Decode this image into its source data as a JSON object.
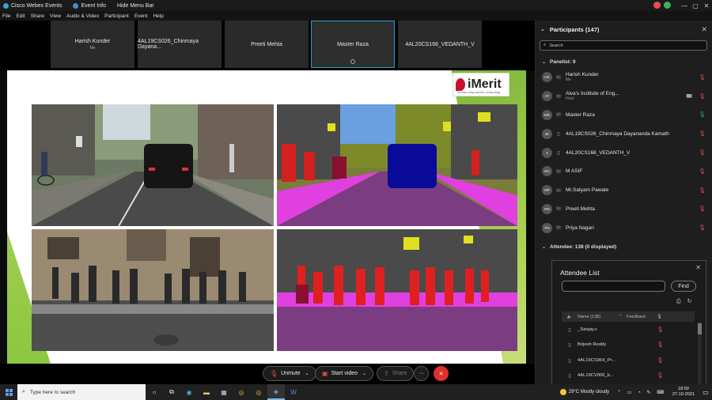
{
  "titlebar": {
    "app_name": "Cisco Webex Events",
    "event_info": "Event Info",
    "hide_menu": "Hide Menu Bar",
    "controls": [
      "—",
      "▢",
      "✕"
    ]
  },
  "menubar": [
    "File",
    "Edit",
    "Share",
    "View",
    "Audio & Video",
    "Participant",
    "Event",
    "Help"
  ],
  "video_strip": [
    {
      "name": "Harish Kunder",
      "sub": "Me",
      "active": false
    },
    {
      "name": "4AL19CS026_Chinmaya Dayana...",
      "sub": "",
      "active": false
    },
    {
      "name": "Preeti Mehta",
      "sub": "",
      "active": false
    },
    {
      "name": "Master Raza",
      "sub": "",
      "active": true
    },
    {
      "name": "4AL20CS168_VEDANTH_V",
      "sub": "",
      "active": false
    }
  ],
  "slide": {
    "logo_name": "iMerit",
    "logo_tagline": "human-empowered computing"
  },
  "toolbar": {
    "unmute": "Unmute",
    "start_video": "Start video",
    "share": "Share",
    "more": "···",
    "leave": "✕"
  },
  "panel": {
    "title": "Participants (147)",
    "search_placeholder": "Search",
    "panelist_section": "Panelist: 9",
    "attendee_section": "Attendee: 138 (0 displayed)",
    "panelists": [
      {
        "initials": "HK",
        "name": "Harish Kunder",
        "role": "Me",
        "mic": "muted",
        "bars": false
      },
      {
        "initials": "AT",
        "name": "Alva's Institute of Eng...",
        "role": "Host",
        "mic": "muted",
        "bars": true
      },
      {
        "initials": "MR",
        "name": "Master Raza",
        "role": "",
        "mic": "on",
        "bars": false
      },
      {
        "initials": "4K",
        "name": "4AL19CS026_Chinmaya Dayananda Kamath",
        "role": "",
        "mic": "muted",
        "bars": false
      },
      {
        "initials": "4",
        "name": "4AL20CS168_VEDANTH_V",
        "role": "",
        "mic": "muted",
        "bars": false
      },
      {
        "initials": "MA",
        "name": "M ASIF",
        "role": "",
        "mic": "muted",
        "bars": false
      },
      {
        "initials": "MP",
        "name": "Mr.Satyam Pawale",
        "role": "",
        "mic": "muted",
        "bars": false
      },
      {
        "initials": "PM",
        "name": "Preeti Mehta",
        "role": "",
        "mic": "muted",
        "bars": false
      },
      {
        "initials": "PN",
        "name": "Priya Nagari",
        "role": "",
        "mic": "muted",
        "bars": false
      }
    ]
  },
  "attendee_list": {
    "title": "Attendee List",
    "find_label": "Find",
    "col_name": "Name (138)",
    "col_feedback": "Feedback",
    "rows": [
      "_Sanjay.c",
      "Brijesh Reddy",
      "4AL19CS064_Pr...",
      "4AL19CV006_b..."
    ]
  },
  "taskbar": {
    "search_placeholder": "Type here to search",
    "temperature": "29°C",
    "weather": "Mostly cloudy",
    "time": "18:59",
    "date": "27-10-2021"
  },
  "colors": {
    "accent_blue": "#2f9bd1",
    "muted_red": "#e05050",
    "mic_on_green": "#3bb35a",
    "leave_red": "#e02f2f",
    "slide_green": "#8cc63f",
    "segmentation_magenta": "#e040e0",
    "segmentation_red": "#e02020"
  }
}
